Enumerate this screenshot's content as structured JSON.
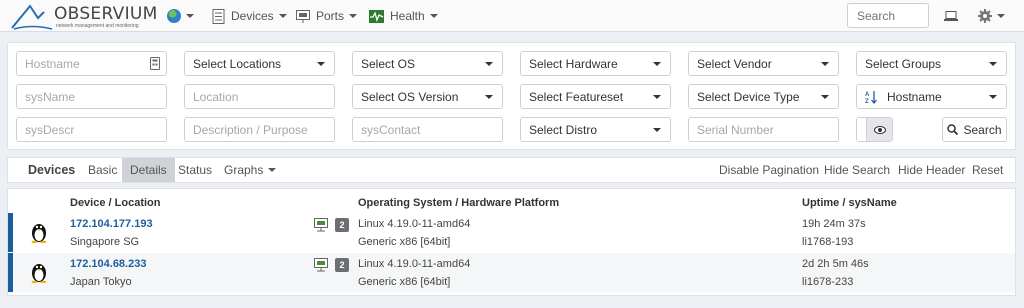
{
  "navbar": {
    "logo_text": "OBSERVIUM",
    "logo_sub": "network management and monitoring",
    "menu": {
      "devices": "Devices",
      "ports": "Ports",
      "health": "Health"
    },
    "search_placeholder": "Search"
  },
  "filters": {
    "hostname_placeholder": "Hostname",
    "select_locations": "Select Locations",
    "select_os": "Select OS",
    "select_hardware": "Select Hardware",
    "select_vendor": "Select Vendor",
    "select_groups": "Select Groups",
    "sysname_placeholder": "sysName",
    "location_placeholder": "Location",
    "select_os_version": "Select OS Version",
    "select_featureset": "Select Featureset",
    "select_device_type": "Select Device Type",
    "sort_value": "Hostname",
    "sysdescr_placeholder": "sysDescr",
    "description_placeholder": "Description / Purpose",
    "syscontact_placeholder": "sysContact",
    "select_distro": "Select Distro",
    "serial_placeholder": "Serial Number",
    "search_button": "Search"
  },
  "tabs": {
    "title": "Devices",
    "basic": "Basic",
    "details": "Details",
    "status": "Status",
    "graphs": "Graphs",
    "disable_pagination": "Disable Pagination",
    "hide_search": "Hide Search",
    "hide_header": "Hide Header",
    "reset": "Reset"
  },
  "table": {
    "headers": {
      "device": "Device / Location",
      "os": "Operating System / Hardware Platform",
      "uptime": "Uptime / sysName"
    },
    "rows": [
      {
        "hostname": "172.104.177.193",
        "location": "Singapore SG",
        "port_count": "2",
        "os": "Linux 4.19.0-11-amd64",
        "hardware": "Generic x86 [64bit]",
        "uptime": "19h 24m 37s",
        "sysname": "li1768-193"
      },
      {
        "hostname": "172.104.68.233",
        "location": "Japan Tokyo",
        "port_count": "2",
        "os": "Linux 4.19.0-11-amd64",
        "hardware": "Generic x86 [64bit]",
        "uptime": "2d 2h 5m 46s",
        "sysname": "li1678-233"
      }
    ]
  },
  "colors": {
    "accent": "#1a5f9c",
    "link": "#1d5f9e",
    "badge": "#6b6e72"
  }
}
